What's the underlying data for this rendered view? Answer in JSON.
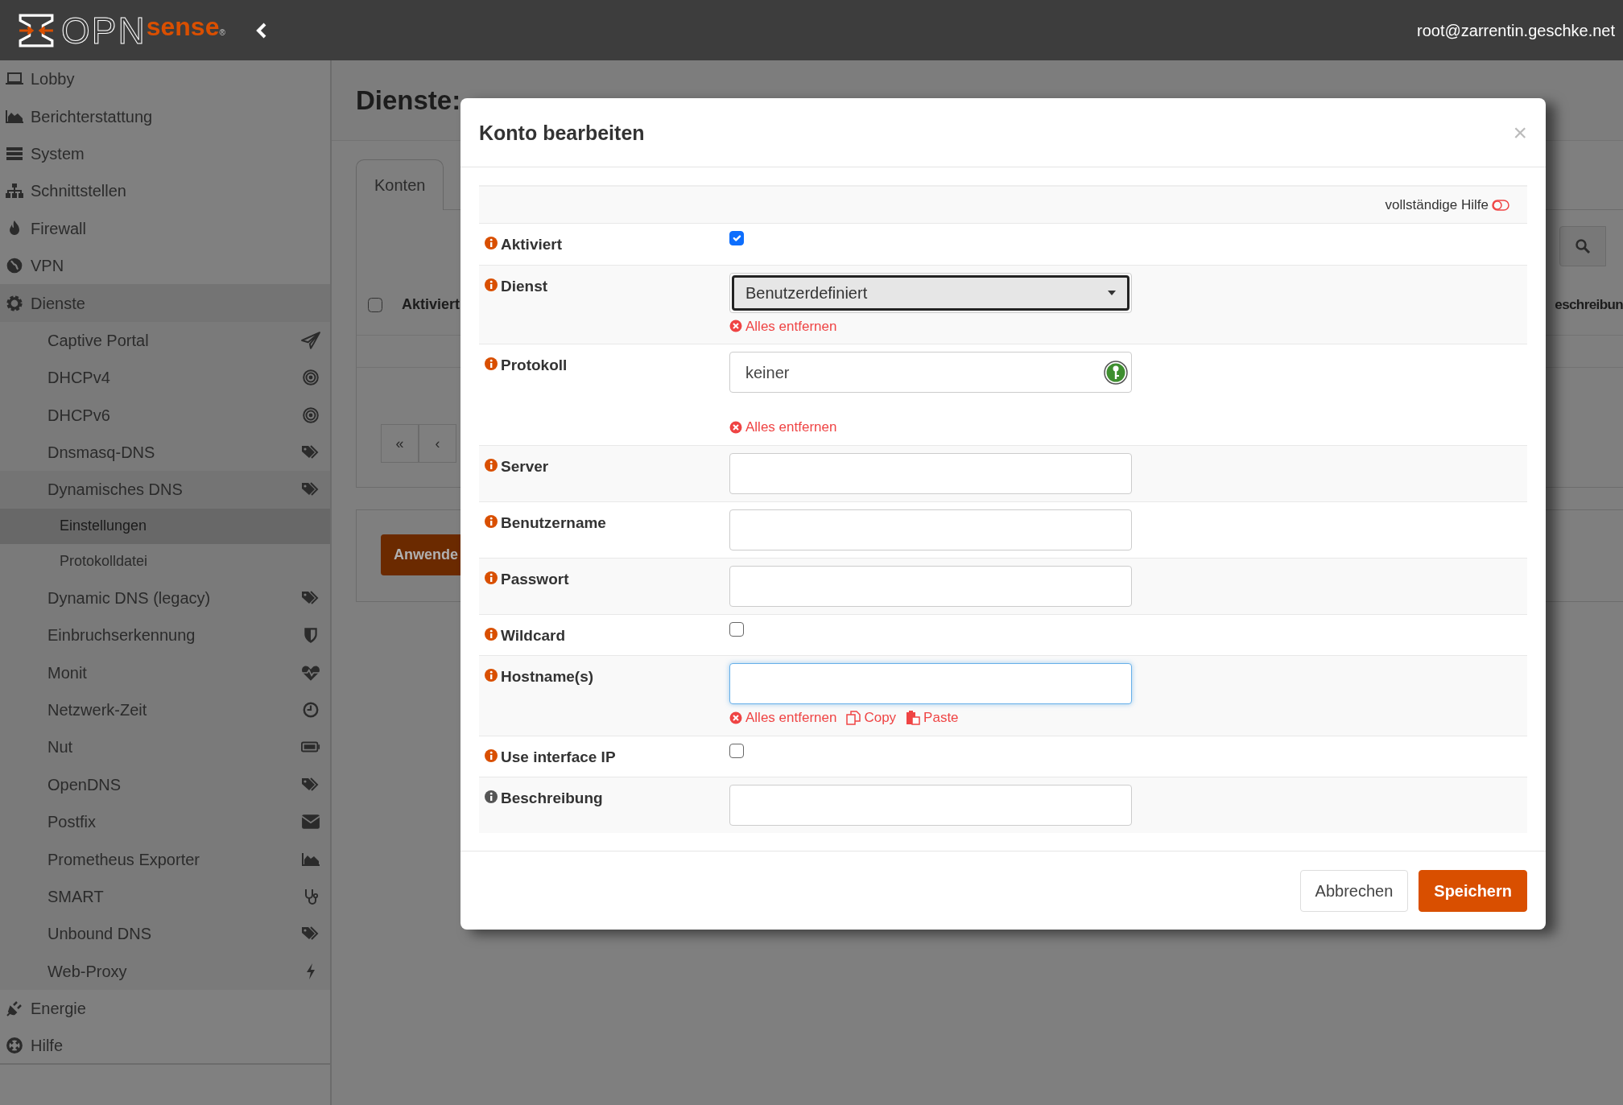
{
  "header": {
    "logo": {
      "text": "OPN",
      "suffix": "sense",
      "mark": "®"
    },
    "user": "root@zarrentin.geschke.net"
  },
  "sidebar": {
    "items": [
      {
        "label": "Lobby",
        "selected": false
      },
      {
        "label": "Berichterstattung",
        "selected": false
      },
      {
        "label": "System",
        "selected": false
      },
      {
        "label": "Schnittstellen",
        "selected": false
      },
      {
        "label": "Firewall",
        "selected": false
      },
      {
        "label": "VPN",
        "selected": false
      },
      {
        "label": "Dienste",
        "selected": false,
        "expanded": true,
        "children": [
          {
            "label": "Captive Portal",
            "selected": false
          },
          {
            "label": "DHCPv4",
            "selected": false
          },
          {
            "label": "DHCPv6",
            "selected": false
          },
          {
            "label": "Dnsmasq-DNS",
            "selected": false
          },
          {
            "label": "Dynamisches DNS",
            "selected": false,
            "expanded": true,
            "children": [
              {
                "label": "Einstellungen",
                "selected": true
              },
              {
                "label": "Protokolldatei",
                "selected": false
              }
            ]
          },
          {
            "label": "Dynamic DNS (legacy)",
            "selected": false
          },
          {
            "label": "Einbruchserkennung",
            "selected": false
          },
          {
            "label": "Monit",
            "selected": false
          },
          {
            "label": "Netzwerk-Zeit",
            "selected": false
          },
          {
            "label": "Nut",
            "selected": false
          },
          {
            "label": "OpenDNS",
            "selected": false
          },
          {
            "label": "Postfix",
            "selected": false
          },
          {
            "label": "Prometheus Exporter",
            "selected": false
          },
          {
            "label": "SMART",
            "selected": false
          },
          {
            "label": "Unbound DNS",
            "selected": false
          },
          {
            "label": "Web-Proxy",
            "selected": false
          }
        ]
      },
      {
        "label": "Energie",
        "selected": false
      },
      {
        "label": "Hilfe",
        "selected": false
      }
    ]
  },
  "page": {
    "title": "Dienste:",
    "tabs": [
      {
        "label": "Konten",
        "selected": true
      }
    ],
    "table": {
      "select_all_checked": false,
      "columns": [
        "Aktiviert",
        "eschreibun"
      ]
    },
    "pager": [
      "«",
      "‹"
    ],
    "apply_button": "Anwende"
  },
  "modal": {
    "title": "Konto bearbeiten",
    "close": "×",
    "help_toggle": {
      "label": "vollständige Hilfe",
      "on": false
    },
    "fields": [
      {
        "label": "Aktiviert",
        "kind": "checkbox",
        "help_active": true,
        "checked": true
      },
      {
        "label": "Dienst",
        "kind": "select",
        "help_active": true,
        "value": "Benutzerdefiniert",
        "actions": [
          {
            "kind": "clear",
            "label": "Alles entfernen"
          }
        ]
      },
      {
        "label": "Protokoll",
        "kind": "tokens",
        "help_active": true,
        "value": "keiner",
        "actions": [
          {
            "kind": "clear",
            "label": "Alles entfernen"
          }
        ]
      },
      {
        "label": "Server",
        "kind": "text",
        "help_active": true,
        "focused": false
      },
      {
        "label": "Benutzername",
        "kind": "text",
        "help_active": true,
        "focused": false
      },
      {
        "label": "Passwort",
        "kind": "text",
        "help_active": true,
        "focused": false
      },
      {
        "label": "Wildcard",
        "kind": "checkbox",
        "help_active": true,
        "checked": false
      },
      {
        "label": "Hostname(s)",
        "kind": "text",
        "help_active": true,
        "focused": true,
        "actions": [
          {
            "kind": "clear",
            "label": "Alles entfernen"
          },
          {
            "kind": "copy",
            "label": "Copy"
          },
          {
            "kind": "paste",
            "label": "Paste"
          }
        ]
      },
      {
        "label": "Use interface IP",
        "kind": "checkbox",
        "help_active": true,
        "checked": false
      },
      {
        "label": "Beschreibung",
        "kind": "text",
        "help_active": false,
        "focused": false
      }
    ],
    "buttons": [
      {
        "label": "Abbrechen",
        "kind": "secondary"
      },
      {
        "label": "Speichern",
        "kind": "primary"
      }
    ]
  }
}
